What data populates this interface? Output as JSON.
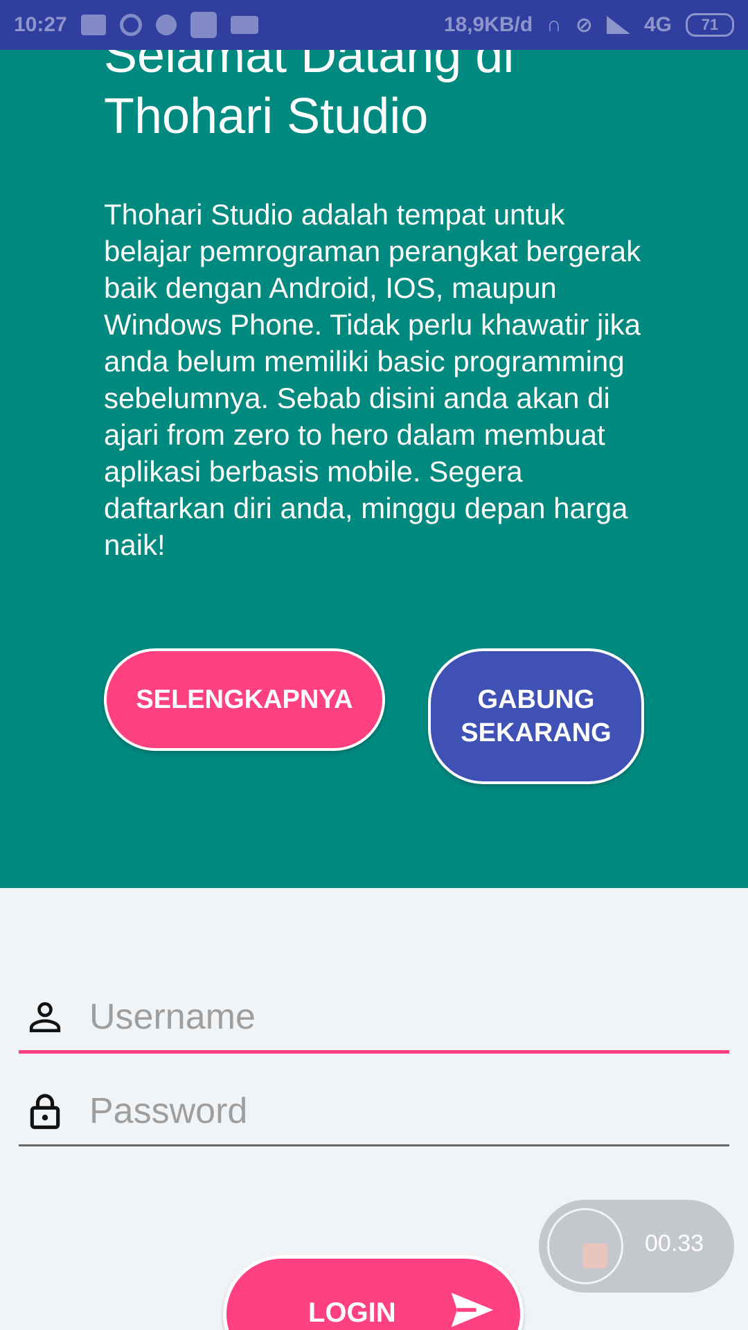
{
  "status_bar": {
    "time": "10:27",
    "speed": "18,9KB/d",
    "network": "4G",
    "battery": "71"
  },
  "hero": {
    "title": "Selamat Datang di Thohari Studio",
    "description": "Thohari Studio adalah tempat untuk belajar pemrograman perangkat bergerak baik dengan Android, IOS, maupun Windows Phone. Tidak perlu khawatir jika anda belum memiliki basic programming sebelumnya. Sebab disini anda akan di ajari from zero to hero dalam membuat aplikasi berbasis mobile. Segera daftarkan diri anda, minggu depan harga naik!",
    "more_button": "SELENGKAPNYA",
    "join_button": "GABUNG SEKARANG"
  },
  "form": {
    "username_placeholder": "Username",
    "password_placeholder": "Password",
    "login_button": "LOGIN"
  },
  "recorder": {
    "time": "00.33"
  },
  "colors": {
    "status_bar": "#303f9f",
    "hero_bg": "#00897f",
    "accent_pink": "#ff4081",
    "indigo": "#3f51b5"
  },
  "icons": {
    "username": "person-icon",
    "password": "lock-icon",
    "login": "send-icon",
    "recorder": "stop-icon"
  }
}
